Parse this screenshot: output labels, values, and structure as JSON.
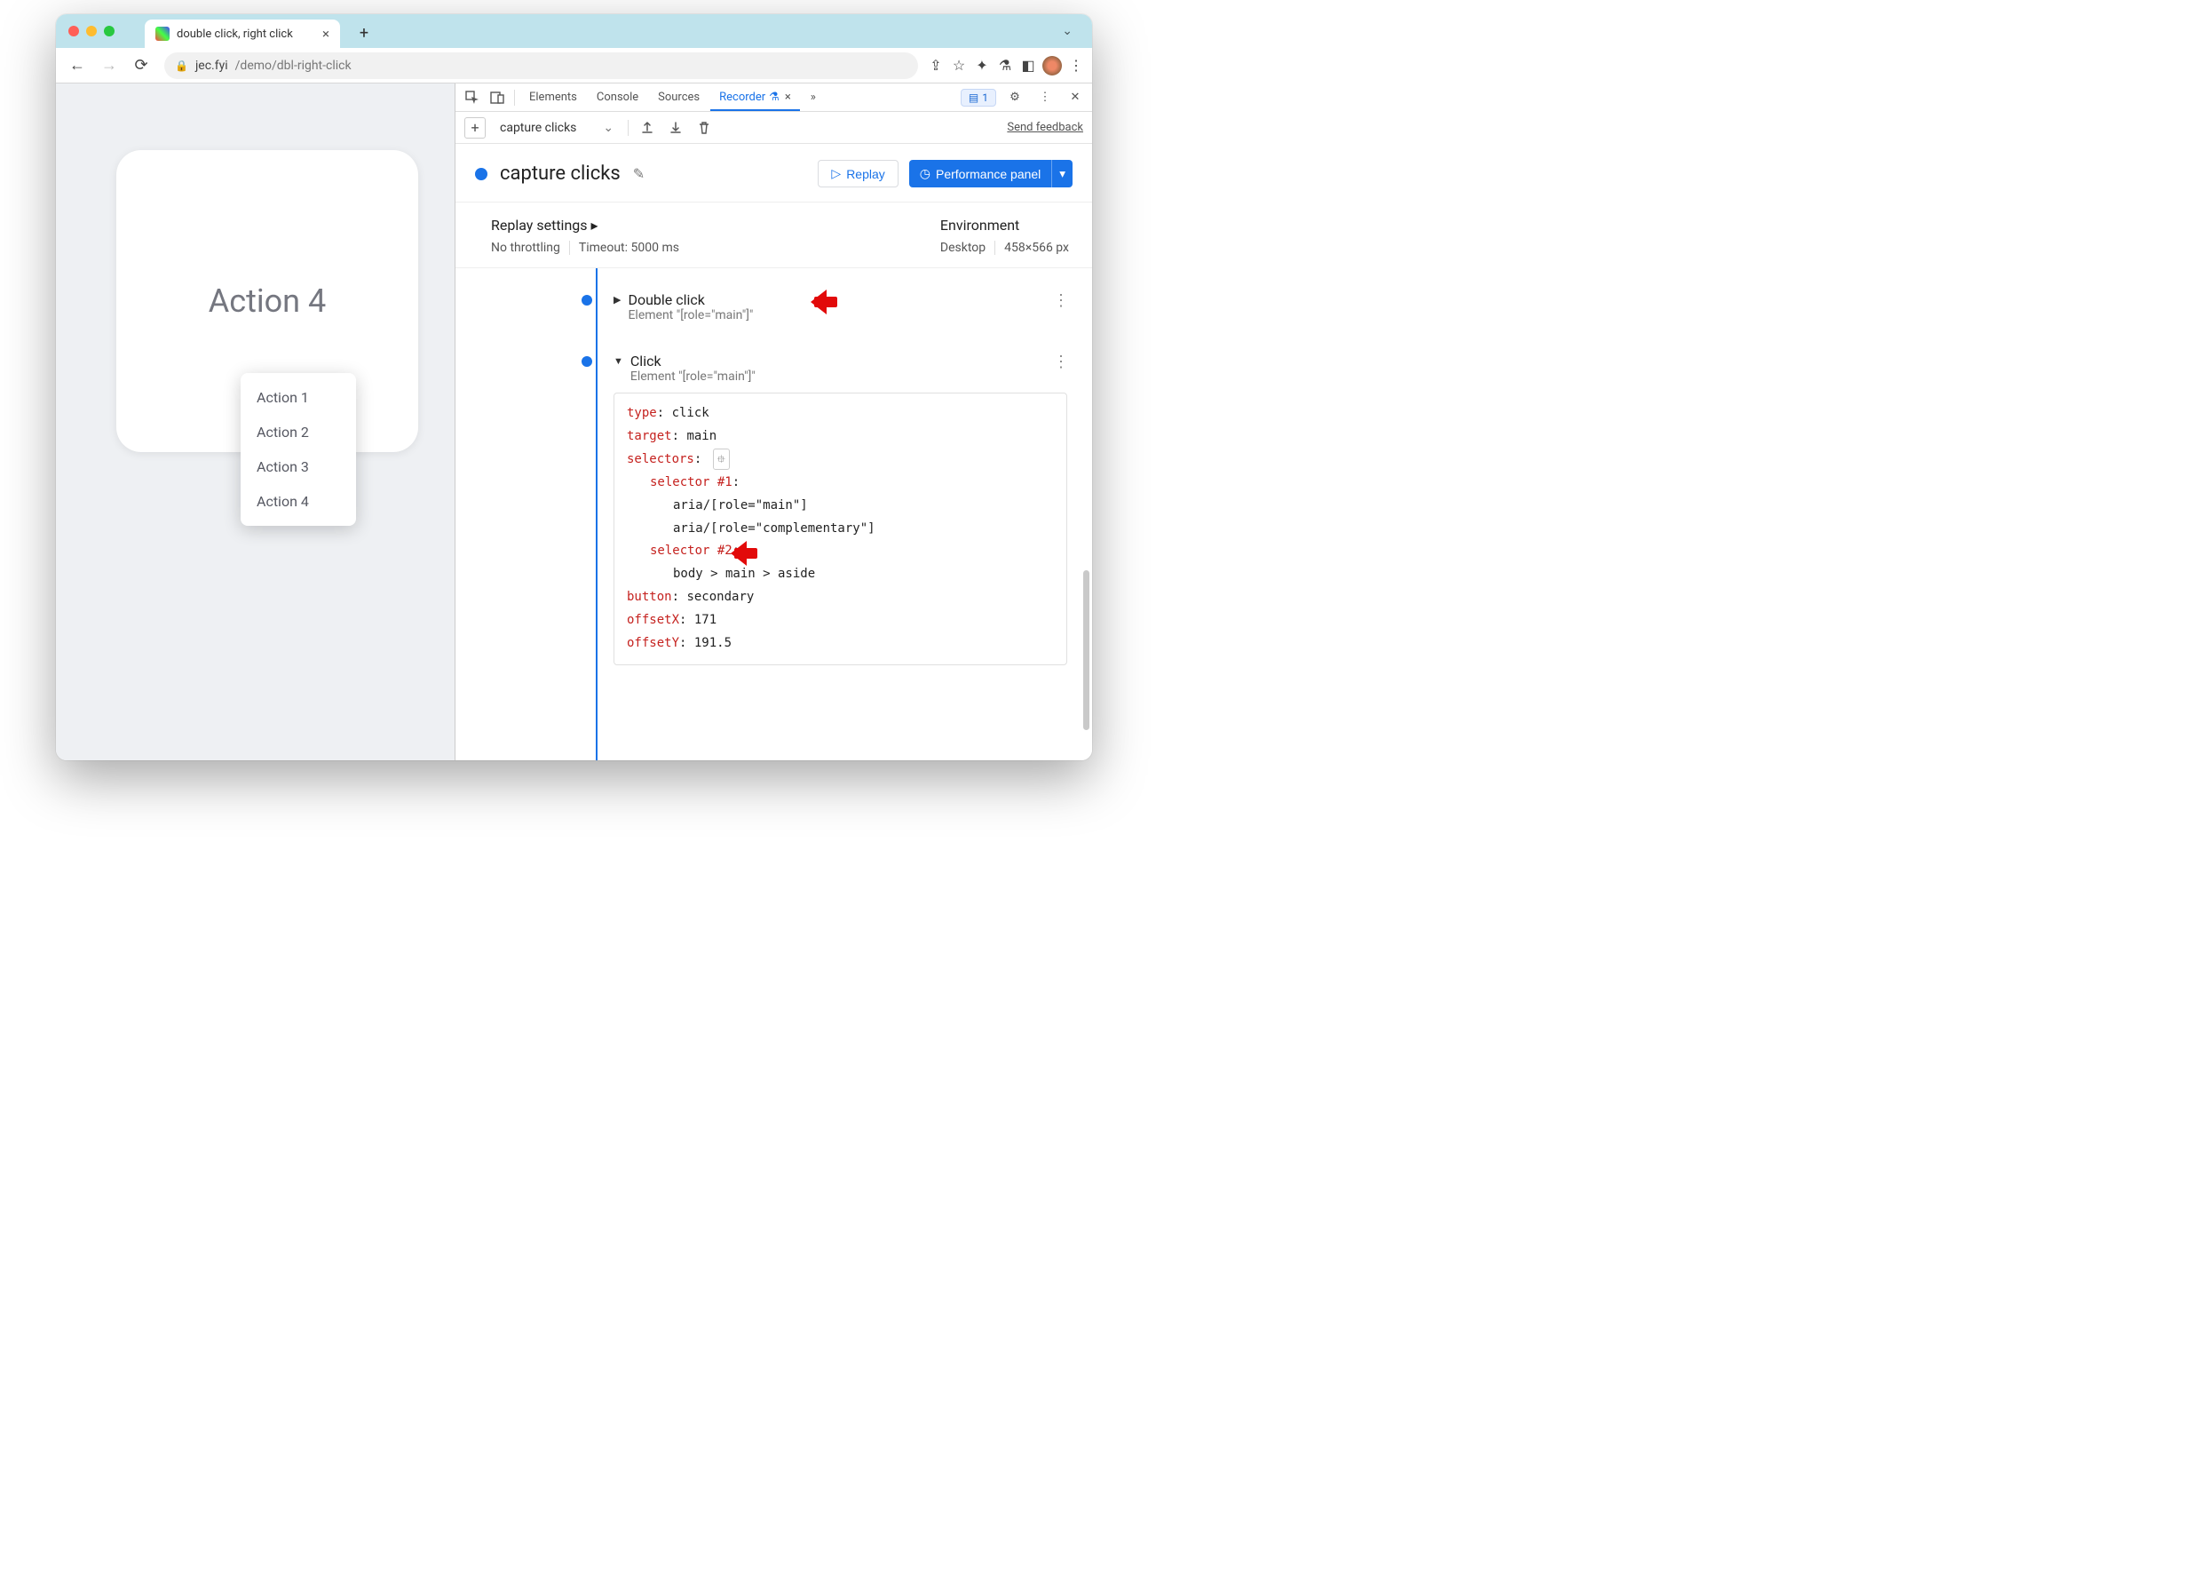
{
  "browser": {
    "tab_title": "double click, right click",
    "url_host": "jec.fyi",
    "url_path": "/demo/dbl-right-click"
  },
  "page": {
    "card_title": "Action 4",
    "menu_items": [
      "Action 1",
      "Action 2",
      "Action 3",
      "Action 4"
    ]
  },
  "devtools": {
    "panels": {
      "elements": "Elements",
      "console": "Console",
      "sources": "Sources",
      "recorder": "Recorder",
      "more": "»"
    },
    "issues_count": "1",
    "recorder": {
      "recording_name": "capture clicks",
      "feedback": "Send feedback",
      "buttons": {
        "replay": "Replay",
        "perf": "Performance panel"
      },
      "settings": {
        "heading": "Replay settings",
        "throttle": "No throttling",
        "timeout": "Timeout: 5000 ms",
        "env_heading": "Environment",
        "device": "Desktop",
        "viewport": "458×566 px"
      },
      "steps": [
        {
          "title": "Double click",
          "subtitle": "Element \"[role=\"main\"]\"",
          "expanded": false
        },
        {
          "title": "Click",
          "subtitle": "Element \"[role=\"main\"]\"",
          "expanded": true,
          "detail": {
            "type": "click",
            "target": "main",
            "selectors_label": "selectors",
            "selector1_label": "selector #1",
            "selector1_a": "aria/[role=\"main\"]",
            "selector1_b": "aria/[role=\"complementary\"]",
            "selector2_label": "selector #2",
            "selector2_a": "body > main > aside",
            "button": "secondary",
            "offsetX": "171",
            "offsetY": "191.5"
          }
        }
      ]
    }
  }
}
